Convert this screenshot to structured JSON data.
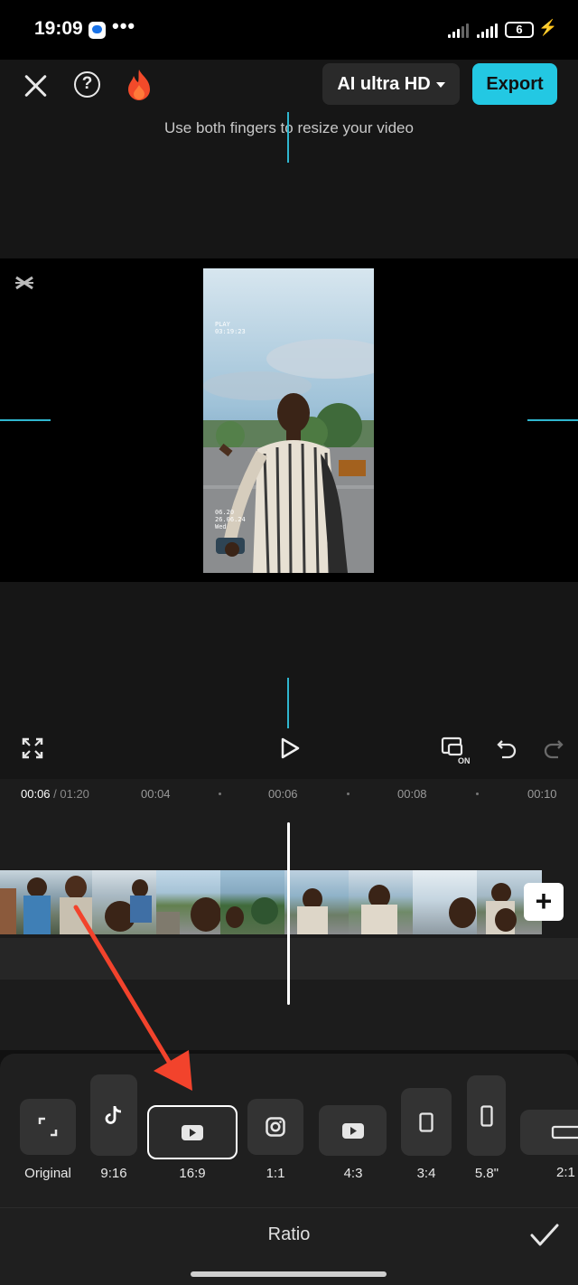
{
  "status_bar": {
    "time": "19:09",
    "more": "•••",
    "battery": "6"
  },
  "toolbar": {
    "quality_label": "AI ultra HD",
    "export_label": "Export",
    "hint": "Use both fingers to resize your video"
  },
  "video": {
    "overlay_top_line1": "PLAY",
    "overlay_top_line2": "03:19:23",
    "overlay_bottom_line1": "06.20",
    "overlay_bottom_line2": "26.06.24",
    "overlay_bottom_line3": "Wed"
  },
  "controls": {
    "fullscreen_icon": "expand-icon",
    "play_icon": "play-icon",
    "keyframe_icon": "preview-on-icon",
    "keyframe_badge": "ON",
    "undo_icon": "undo-icon",
    "redo_icon": "redo-icon"
  },
  "timeline": {
    "current_time": "00:06",
    "total_time": " / 01:20",
    "ticks": [
      "00:04",
      "00:06",
      "00:08",
      "00:10"
    ],
    "add_label": "+"
  },
  "ratio_panel": {
    "title": "Ratio",
    "options": [
      {
        "label": "Original",
        "icon": "crop-corners-icon"
      },
      {
        "label": "9:16",
        "icon": "tiktok-icon"
      },
      {
        "label": "16:9",
        "icon": "youtube-icon",
        "selected": true
      },
      {
        "label": "1:1",
        "icon": "instagram-icon"
      },
      {
        "label": "4:3",
        "icon": "youtube-icon"
      },
      {
        "label": "3:4",
        "icon": "portrait-rect-icon"
      },
      {
        "label": "5.8\"",
        "icon": "phone-rect-icon"
      },
      {
        "label": "2:1",
        "icon": "landscape-rect-icon"
      }
    ]
  },
  "colors": {
    "accent": "#23c8e3",
    "guide": "#2fb6cf",
    "arrow": "#f2432c"
  }
}
